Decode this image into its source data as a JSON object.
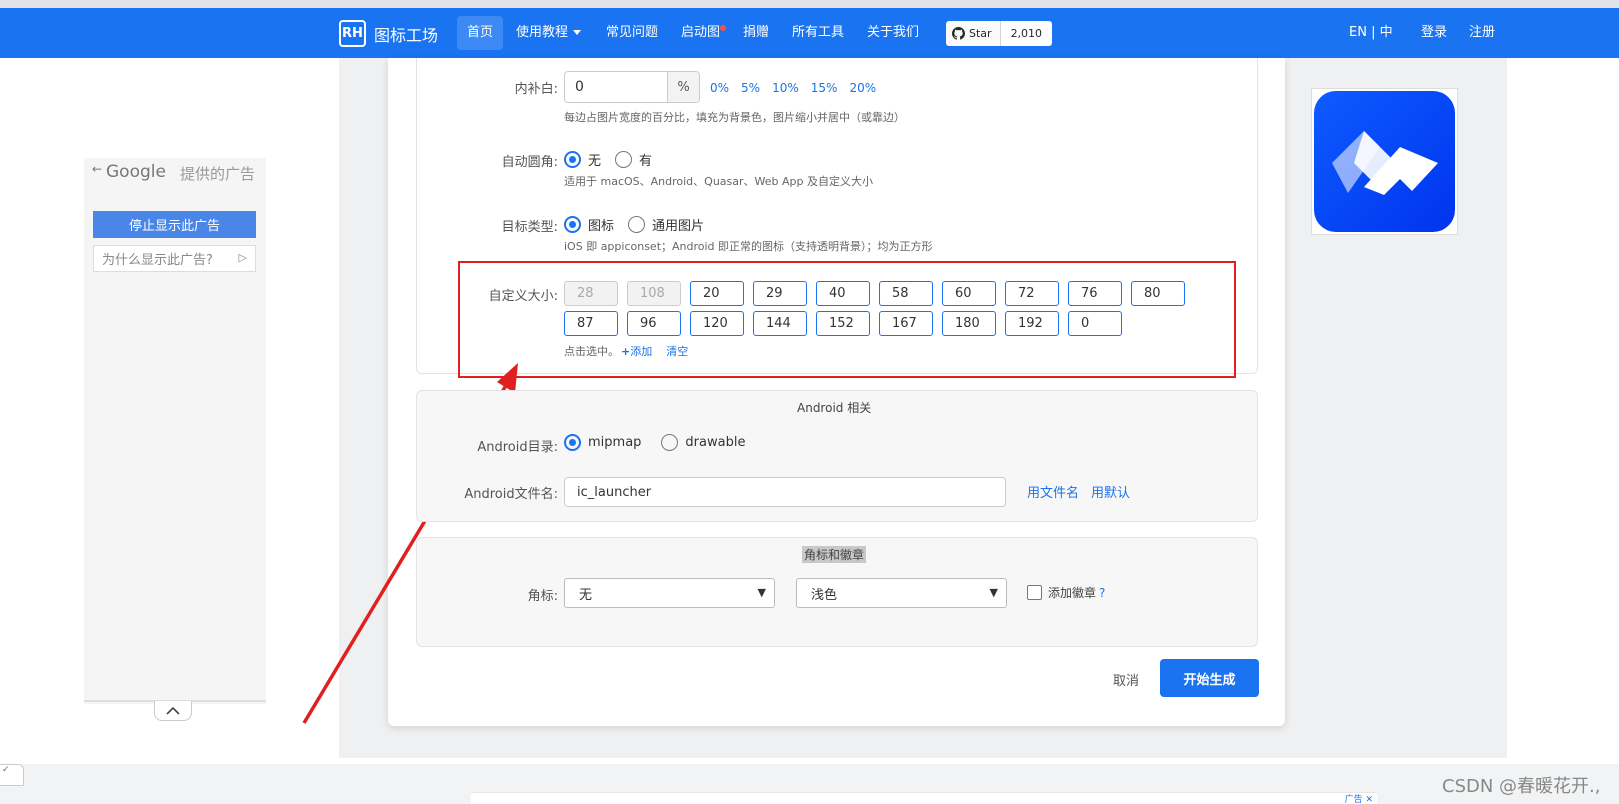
{
  "navbar": {
    "logo_text": "RH",
    "brand": "图标工场",
    "items": [
      "首页",
      "使用教程",
      "常见问题",
      "启动图",
      "捐赠",
      "所有工具",
      "关于我们"
    ],
    "github": {
      "star_label": "Star",
      "count": "2,010"
    },
    "lang": "EN | 中",
    "login": "登录",
    "register": "注册"
  },
  "ad": {
    "google": "Google",
    "provided_by": "提供的广告",
    "stop_label": "停止显示此广告",
    "why_label": "为什么显示此广告?"
  },
  "form": {
    "padding": {
      "label": "内补白:",
      "value": "0",
      "unit": "%",
      "presets": [
        "0%",
        "5%",
        "10%",
        "15%",
        "20%"
      ],
      "hint": "每边占图片宽度的百分比，填充为背景色，图片缩小并居中（或靠边）"
    },
    "corner": {
      "label": "自动圆角:",
      "options": [
        "无",
        "有"
      ],
      "hint": "适用于 macOS、Android、Quasar、Web App 及自定义大小"
    },
    "target": {
      "label": "目标类型:",
      "options": [
        "图标",
        "通用图片"
      ],
      "hint": "iOS 即 appiconset；Android 即正常的图标（支持透明背景）；均为正方形"
    },
    "sizes": {
      "label": "自定义大小:",
      "row1": [
        "28",
        "108",
        "20",
        "29",
        "40",
        "58",
        "60",
        "72",
        "76",
        "80"
      ],
      "row2": [
        "87",
        "96",
        "120",
        "144",
        "152",
        "167",
        "180",
        "192",
        "0"
      ],
      "hint": "点击选中。",
      "add_label": "添加",
      "clear_label": "清空"
    },
    "android": {
      "title": "Android 相关",
      "dir_label": "Android目录:",
      "dir_options": [
        "mipmap",
        "drawable"
      ],
      "file_label": "Android文件名:",
      "file_value": "ic_launcher",
      "use_filename": "用文件名",
      "use_default": "用默认"
    },
    "badge": {
      "title": "角标和徽章",
      "label": "角标:",
      "select1": "无",
      "select2": "浅色",
      "add_badge": "添加徽章",
      "help": "?"
    },
    "cancel_label": "取消",
    "submit_label": "开始生成"
  },
  "bottom": {
    "ad_label": "广告 ✕",
    "watermark": "CSDN @春暖花开.,"
  },
  "colors": {
    "primary": "#1a73f0",
    "annotation": "#e02020"
  }
}
